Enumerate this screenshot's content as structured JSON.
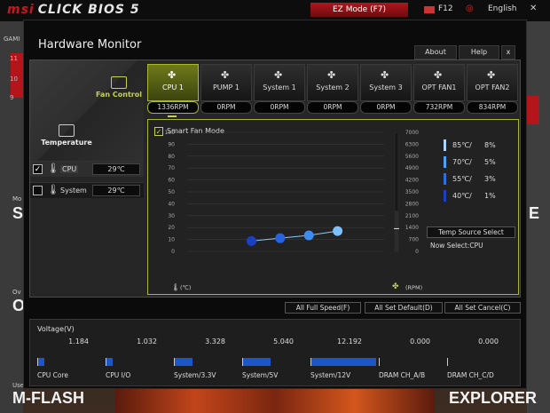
{
  "background": {
    "brand": "CLICK BIOS 5",
    "ez_mode": "EZ Mode (F7)",
    "f12": "F12",
    "language": "English",
    "left_labels": [
      "GAMI",
      "Mo",
      "SE",
      "Ov",
      "O",
      "Use",
      "M-FLASH"
    ],
    "left_numbers": [
      "11",
      "10",
      "9"
    ],
    "right_labels": [
      "E",
      "EXPLORER"
    ]
  },
  "window": {
    "title": "Hardware Monitor",
    "about": "About",
    "help": "Help",
    "close": "x"
  },
  "nav": {
    "fan_control": "Fan Control",
    "temperature": "Temperature"
  },
  "sensors": [
    {
      "name": "CPU",
      "value": "29℃",
      "checked": true
    },
    {
      "name": "System",
      "value": "29℃",
      "checked": false
    }
  ],
  "fans": [
    {
      "name": "CPU 1",
      "rpm": "1336RPM",
      "active": true
    },
    {
      "name": "PUMP 1",
      "rpm": "0RPM",
      "active": false
    },
    {
      "name": "System 1",
      "rpm": "0RPM",
      "active": false
    },
    {
      "name": "System 2",
      "rpm": "0RPM",
      "active": false
    },
    {
      "name": "System 3",
      "rpm": "0RPM",
      "active": false
    },
    {
      "name": "OPT FAN1",
      "rpm": "732RPM",
      "active": false
    },
    {
      "name": "OPT FAN2",
      "rpm": "834RPM",
      "active": false
    }
  ],
  "smart_fan": {
    "label": "Smart Fan Mode",
    "checked": true,
    "temp_unit": "(℃)",
    "rpm_unit": "(RPM)",
    "temp_source_button": "Temp Source Select",
    "now_select": "Now Select:CPU"
  },
  "chart_data": {
    "type": "line",
    "y_left_ticks": [
      "100",
      "90",
      "80",
      "70",
      "60",
      "50",
      "40",
      "30",
      "20",
      "10",
      "0"
    ],
    "y_right_ticks": [
      "7000",
      "6300",
      "5600",
      "4900",
      "4200",
      "3500",
      "2800",
      "2100",
      "1400",
      "700",
      "0"
    ],
    "ylim_left": [
      0,
      100
    ],
    "ylim_right": [
      0,
      7000
    ],
    "points": [
      {
        "temp": 40,
        "percent": 1
      },
      {
        "temp": 55,
        "percent": 3
      },
      {
        "temp": 70,
        "percent": 5
      },
      {
        "temp": 85,
        "percent": 8
      }
    ],
    "point_colors": [
      "#1c3fc4",
      "#2a63e0",
      "#3d8cf0",
      "#7cc0ff"
    ],
    "current_rpm": 1336
  },
  "curve_legend": [
    {
      "temp": "85℃/",
      "pct": "8%",
      "color": "#a8d4ff"
    },
    {
      "temp": "70℃/",
      "pct": "5%",
      "color": "#4ba2f7"
    },
    {
      "temp": "55℃/",
      "pct": "3%",
      "color": "#2a6ee6"
    },
    {
      "temp": "40℃/",
      "pct": "1%",
      "color": "#1c3fc4"
    }
  ],
  "actions": {
    "full_speed": "All Full Speed(F)",
    "set_default": "All Set Default(D)",
    "set_cancel": "All Set Cancel(C)"
  },
  "voltage": {
    "title": "Voltage(V)",
    "rails": [
      {
        "name": "CPU Core",
        "value": "1.184",
        "level": 0.1
      },
      {
        "name": "CPU I/O",
        "value": "1.032",
        "level": 0.1
      },
      {
        "name": "System/3.3V",
        "value": "3.328",
        "level": 0.28
      },
      {
        "name": "System/5V",
        "value": "5.040",
        "level": 0.42
      },
      {
        "name": "System/12V",
        "value": "12.192",
        "level": 1.0
      },
      {
        "name": "DRAM CH_A/B",
        "value": "0.000",
        "level": 0
      },
      {
        "name": "DRAM CH_C/D",
        "value": "0.000",
        "level": 0
      }
    ]
  }
}
